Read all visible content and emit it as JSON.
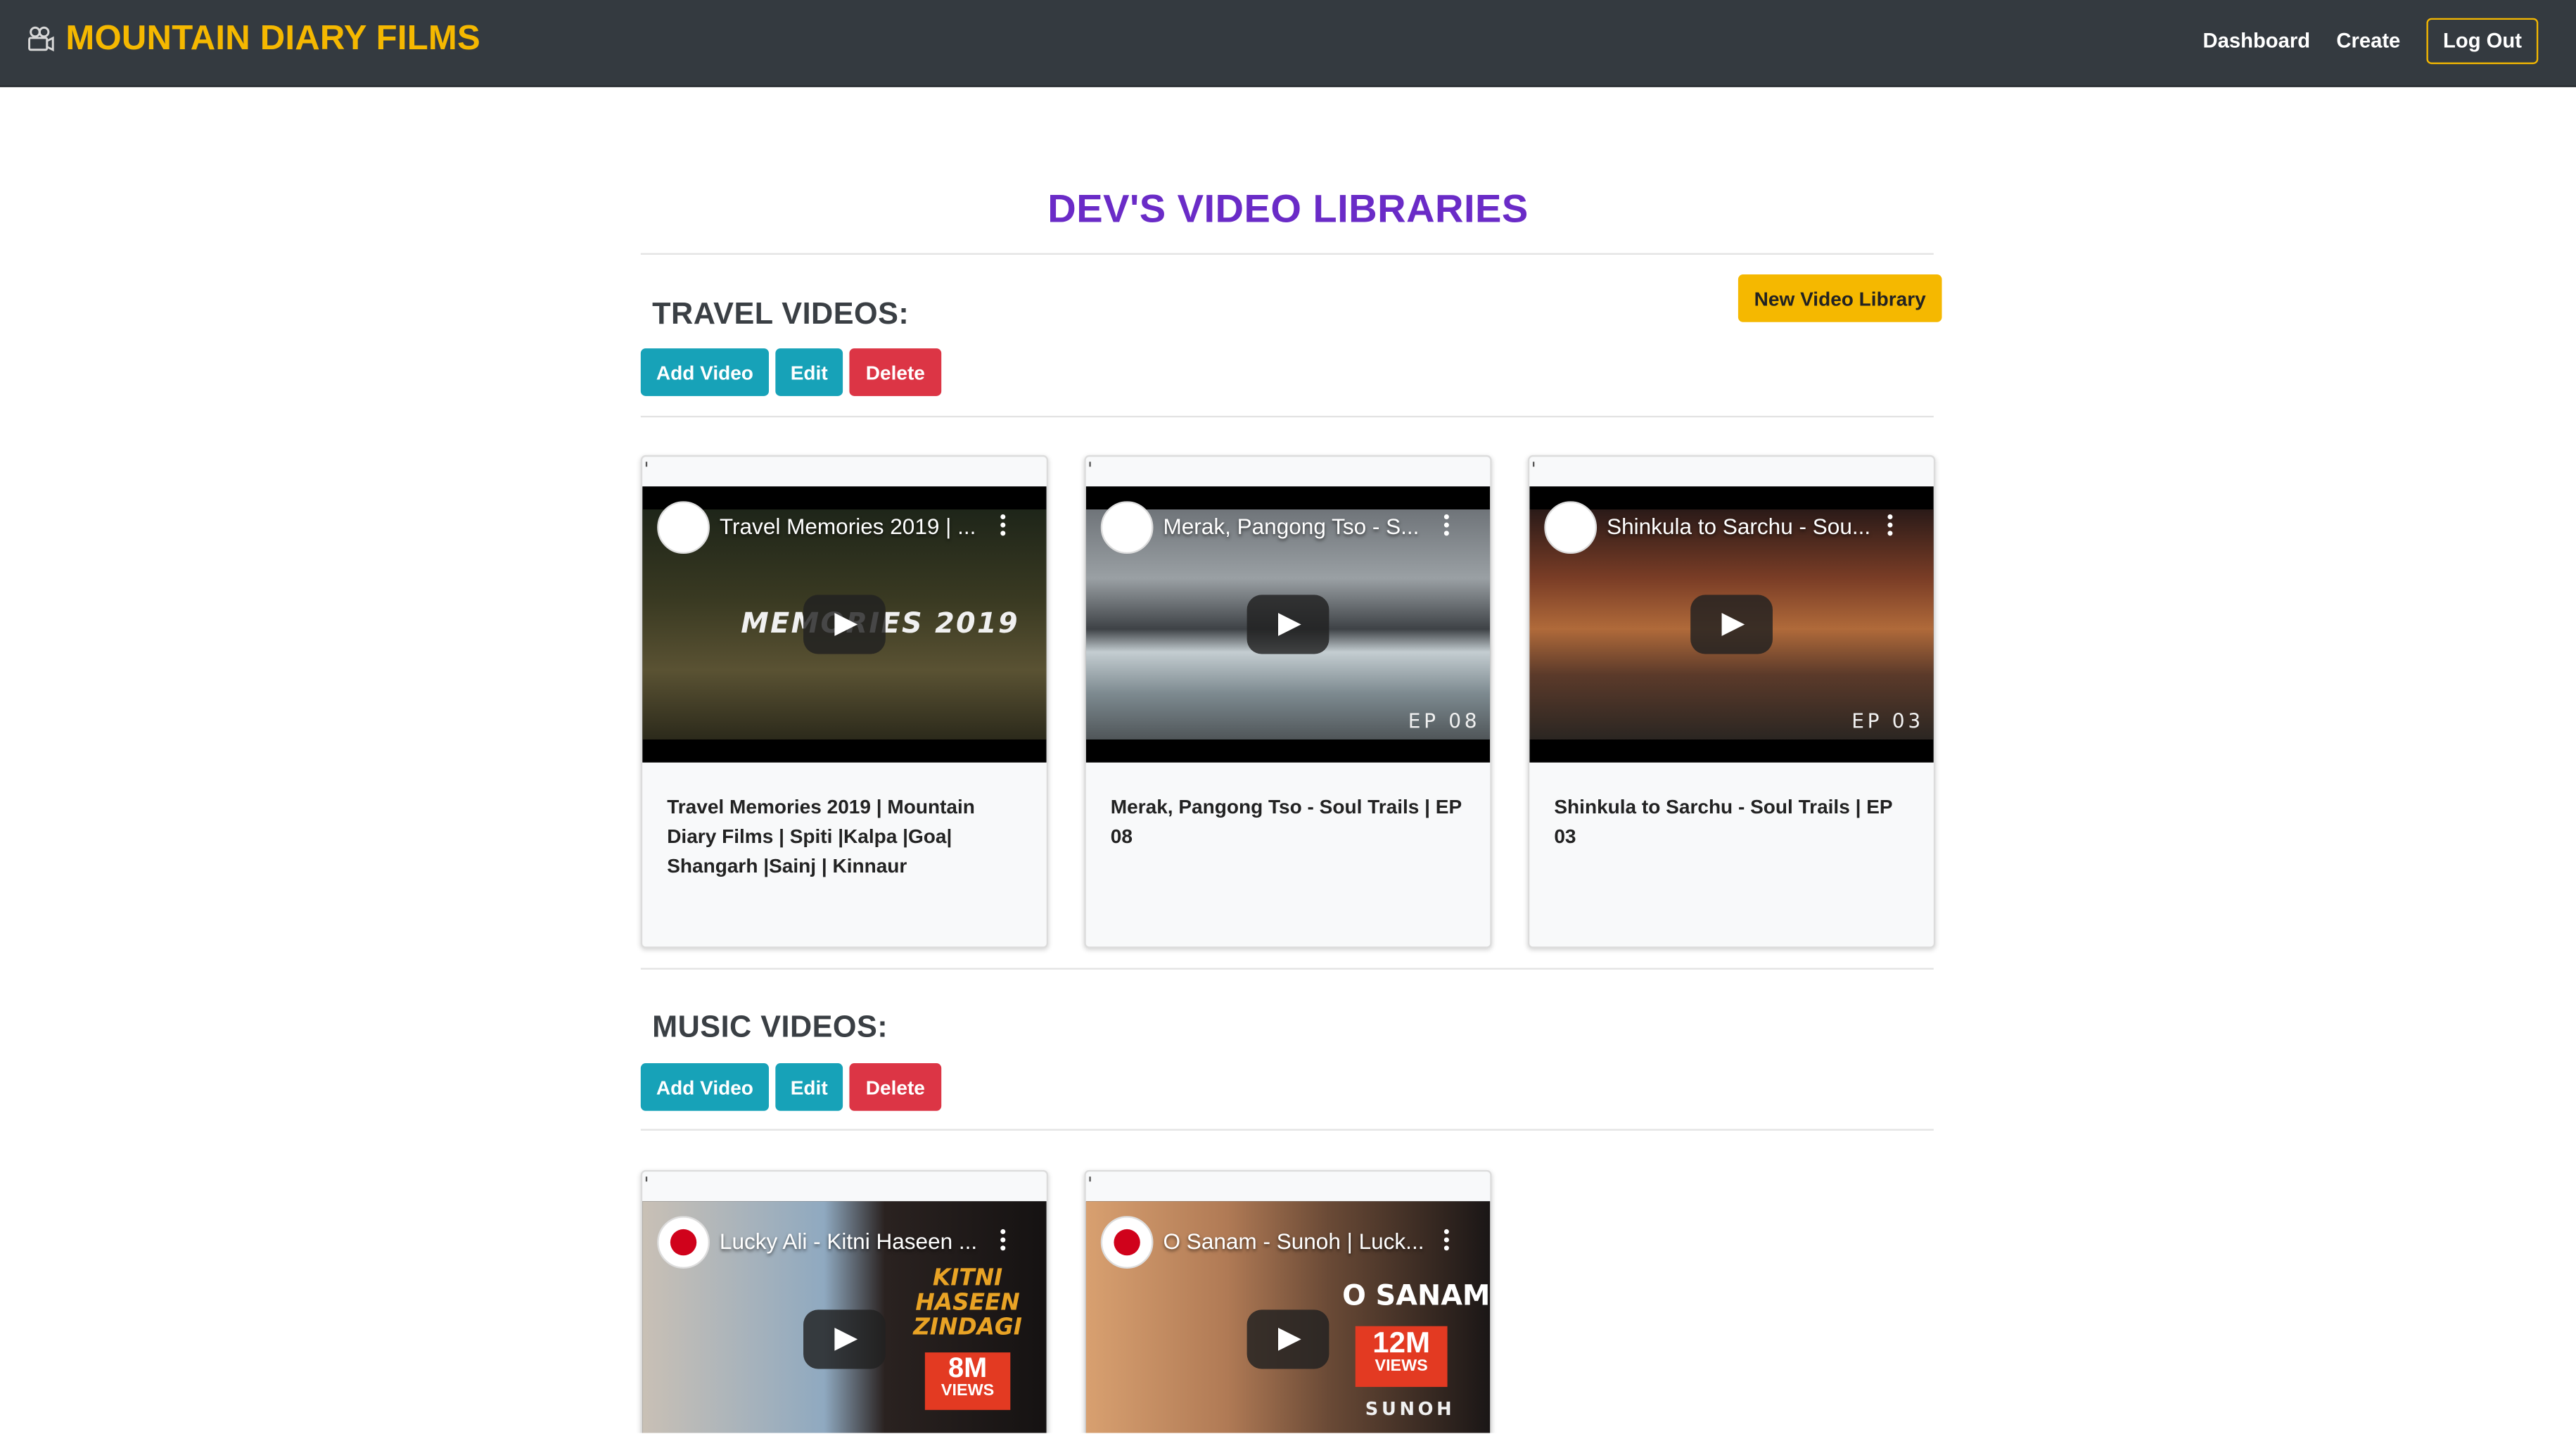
{
  "navbar": {
    "brand": "MOUNTAIN DIARY FILMS",
    "brand_icon": "camera-icon",
    "links": [
      "Dashboard",
      "Create"
    ],
    "logout": "Log Out",
    "colors": {
      "background": "#343a40",
      "brand": "#f5b800"
    }
  },
  "page": {
    "title": "DEV'S VIDEO LIBRARIES",
    "new_library_button": "New Video Library",
    "title_color": "#6a2bc7"
  },
  "libraries": [
    {
      "title": "TRAVEL VIDEOS:",
      "buttons": {
        "add": "Add Video",
        "edit": "Edit",
        "delete": "Delete"
      },
      "videos": [
        {
          "yt_title": "Travel Memories 2019 | ...",
          "overlay": "MEMORIES 2019",
          "title": "Travel Memories 2019 | Mountain Diary Films | Spiti |Kalpa |Goa| Shangarh |Sainj | Kinnaur"
        },
        {
          "yt_title": "Merak, Pangong Tso - S...",
          "overlay": "EP 08",
          "title": "Merak, Pangong Tso - Soul Trails | EP 08"
        },
        {
          "yt_title": "Shinkula to Sarchu - Sou...",
          "overlay": "EP 03",
          "title": "Shinkula to Sarchu - Soul Trails | EP 03"
        }
      ]
    },
    {
      "title": "MUSIC VIDEOS:",
      "buttons": {
        "add": "Add Video",
        "edit": "Edit",
        "delete": "Delete"
      },
      "videos": [
        {
          "yt_title": "Lucky Ali - Kitni Haseen ...",
          "overlay": "KITNI HASEEN ZINDAGI",
          "views_big": "8M",
          "views_small": "VIEWS"
        },
        {
          "yt_title": "O Sanam - Sunoh | Luck...",
          "overlay": "O SANAM",
          "views_big": "12M",
          "views_small": "VIEWS",
          "footer": "SUNOH"
        }
      ]
    }
  ]
}
